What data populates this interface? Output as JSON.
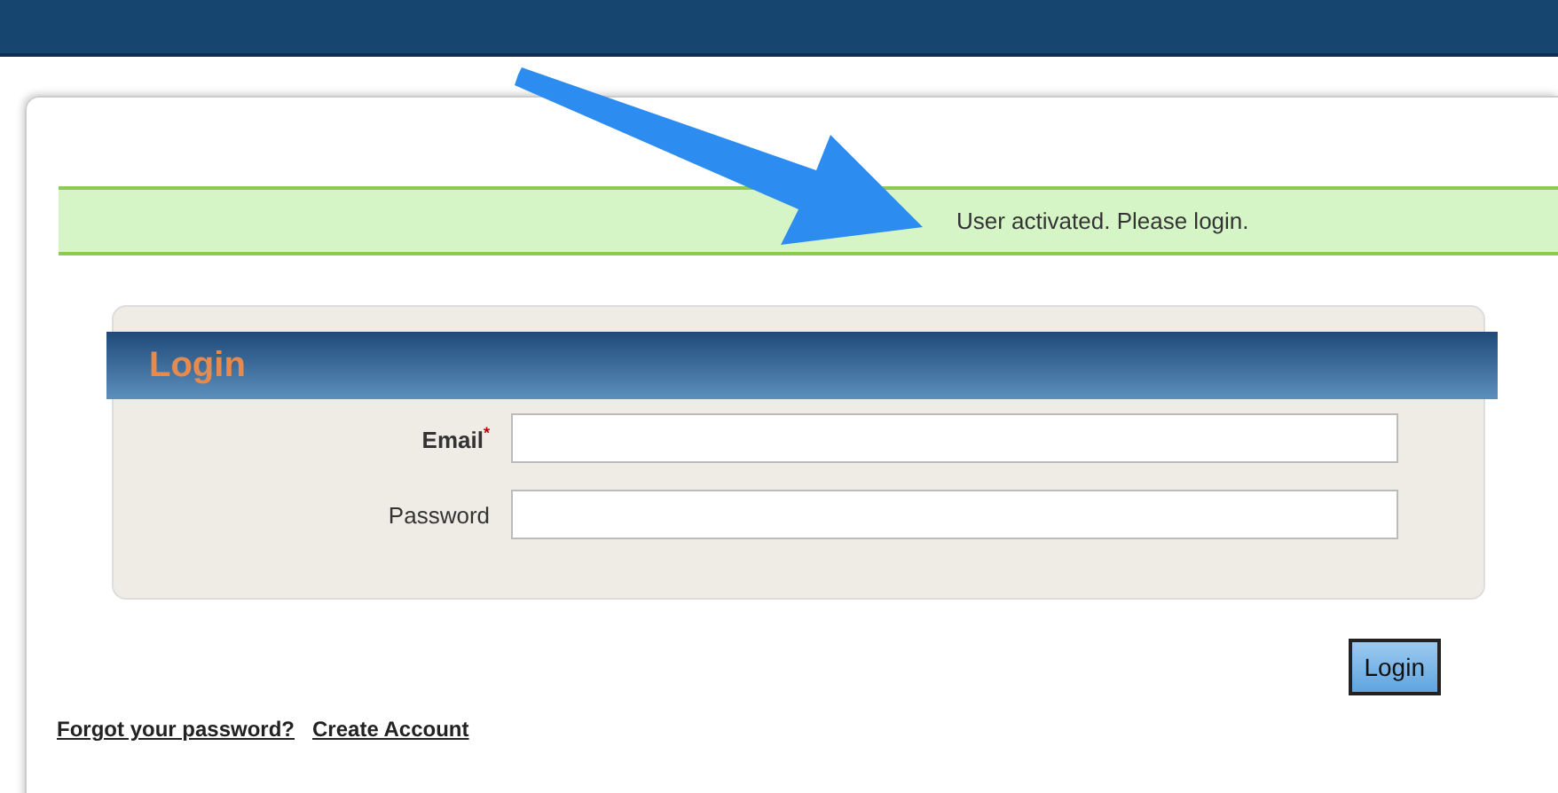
{
  "message": {
    "text": "User activated. Please login."
  },
  "login": {
    "title": "Login",
    "fields": [
      {
        "label": "Email",
        "required_mark": "*"
      },
      {
        "label": "Password"
      }
    ],
    "submit": "Login"
  },
  "links": [
    "Forgot your password?",
    "Create Account"
  ]
}
